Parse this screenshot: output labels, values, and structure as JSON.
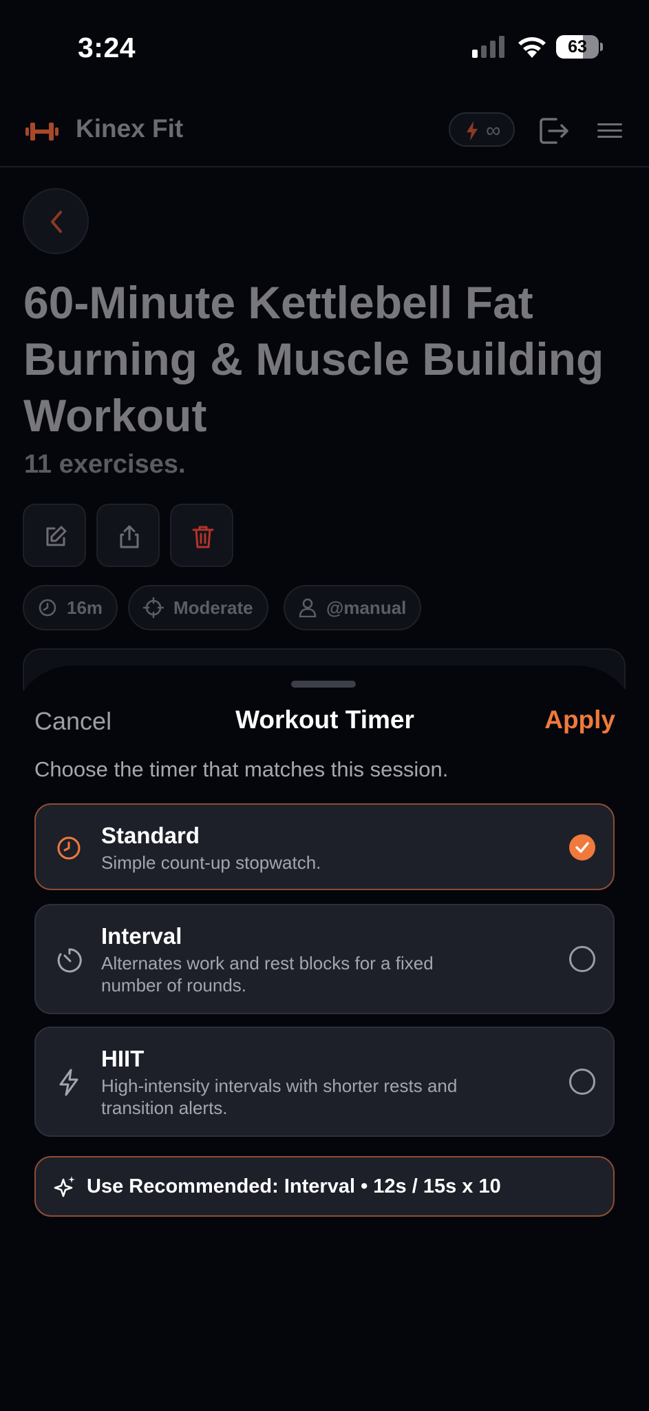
{
  "status_bar": {
    "time": "3:24",
    "battery": "63",
    "battery_level": 0.63
  },
  "header": {
    "brand": "Kinex Fit",
    "energy_label": "∞"
  },
  "workout": {
    "title": "60-Minute Kettlebell Fat Burning & Muscle Building Workout",
    "exercise_count": "11 exercises.",
    "chips": {
      "duration": "16m",
      "difficulty": "Moderate",
      "author": "@manual"
    }
  },
  "sheet": {
    "cancel_label": "Cancel",
    "title": "Workout Timer",
    "apply_label": "Apply",
    "description": "Choose the timer that matches this session.",
    "options": [
      {
        "name": "Standard",
        "description": "Simple count-up stopwatch.",
        "selected": true
      },
      {
        "name": "Interval",
        "description": "Alternates work and rest blocks for a fixed number of rounds.",
        "selected": false
      },
      {
        "name": "HIIT",
        "description": "High-intensity intervals with shorter rests and transition alerts.",
        "selected": false
      }
    ],
    "recommended_label": "Use Recommended: Interval • 12s / 15s x 10"
  },
  "colors": {
    "accent": "#f07a3c",
    "danger": "#b3342c",
    "background": "#05060b",
    "card": "#1d2029"
  }
}
